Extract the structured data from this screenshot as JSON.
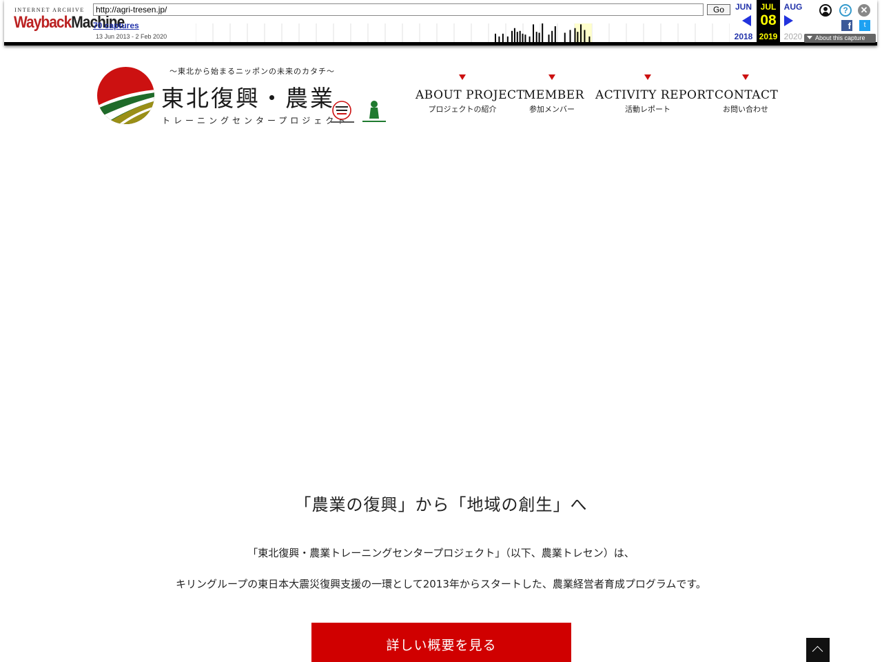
{
  "wayback": {
    "logo_top": "INTERNET ARCHIVE",
    "logo_main_a": "Wayback",
    "logo_main_b": "Machine",
    "url": "http://agri-tresen.jp/",
    "go_label": "Go",
    "captures_label": "70 captures",
    "date_range": "13 Jun 2013 - 2 Feb 2020",
    "prev_month": "JUN",
    "prev_year": "2018",
    "current_month": "JUL",
    "current_day": "08",
    "current_year": "2019",
    "next_month": "AUG",
    "next_year": "2020",
    "about_label": "About this capture",
    "help_glyph": "?",
    "close_glyph": "✕",
    "facebook_glyph": "f",
    "twitter_glyph": "t",
    "spark_bars": [
      {
        "m": 0.56,
        "h": 0.45
      },
      {
        "m": 0.567,
        "h": 0.3
      },
      {
        "m": 0.574,
        "h": 0.45
      },
      {
        "m": 0.583,
        "h": 0.3
      },
      {
        "m": 0.591,
        "h": 0.6
      },
      {
        "m": 0.596,
        "h": 0.75
      },
      {
        "m": 0.601,
        "h": 0.55
      },
      {
        "m": 0.606,
        "h": 0.6
      },
      {
        "m": 0.611,
        "h": 0.45
      },
      {
        "m": 0.616,
        "h": 0.4
      },
      {
        "m": 0.624,
        "h": 0.3
      },
      {
        "m": 0.631,
        "h": 0.95
      },
      {
        "m": 0.637,
        "h": 0.55
      },
      {
        "m": 0.642,
        "h": 0.5
      },
      {
        "m": 0.648,
        "h": 1.0
      },
      {
        "m": 0.66,
        "h": 0.4
      },
      {
        "m": 0.666,
        "h": 0.6
      },
      {
        "m": 0.672,
        "h": 0.85
      },
      {
        "m": 0.69,
        "h": 0.5
      },
      {
        "m": 0.7,
        "h": 0.65
      },
      {
        "m": 0.709,
        "h": 0.75
      },
      {
        "m": 0.714,
        "h": 0.55
      },
      {
        "m": 0.72,
        "h": 0.95
      },
      {
        "m": 0.727,
        "h": 0.65
      },
      {
        "m": 0.736,
        "h": 0.3
      }
    ],
    "spark_highlight_month": 0.725
  },
  "site": {
    "tagline": "〜東北から始まるニッポンの未来のカタチ〜",
    "title": "東北復興・農業",
    "subtitle": "トレーニングセンタープロジェクト",
    "colors": {
      "red": "#cc1111",
      "green_dark": "#1f6b2a",
      "green_light": "#3f8f36",
      "olive": "#9a8f17",
      "button_red": "#d00000"
    }
  },
  "nav": {
    "about": {
      "en": "ABOUT PROJECT",
      "jp": "プロジェクトの紹介"
    },
    "member": {
      "en": "MEMBER",
      "jp": "参加メンバー"
    },
    "activity": {
      "en": "ACTIVITY REPORT",
      "jp": "活動レポート"
    },
    "contact": {
      "en": "CONTACT",
      "jp": "お問い合わせ"
    }
  },
  "content": {
    "headline": "「農業の復興」から「地域の創生」へ",
    "intro_line1": "「東北復興・農業トレーニングセンタープロジェクト」（以下、農業トレセン）は、",
    "intro_line2": "キリングループの東日本大震災復興支援の一環として2013年からスタートした、農業経営者育成プログラムです。",
    "detail_button": "詳しい概要を見る"
  }
}
